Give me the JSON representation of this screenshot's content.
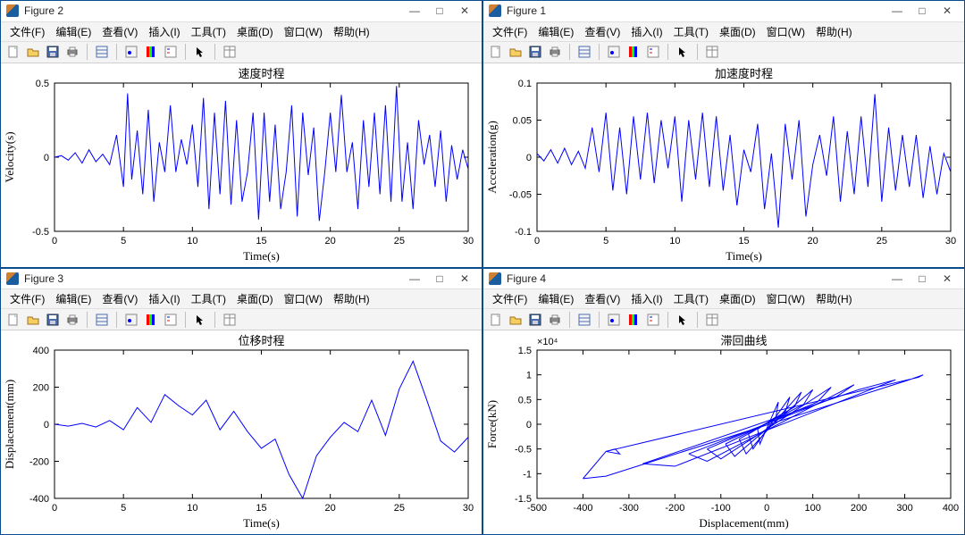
{
  "menus": {
    "file": "文件(F)",
    "edit": "编辑(E)",
    "view": "查看(V)",
    "insert": "插入(I)",
    "tool": "工具(T)",
    "desktop": "桌面(D)",
    "window": "窗口(W)",
    "help": "帮助(H)"
  },
  "windows": {
    "fig2": {
      "title": "Figure 2"
    },
    "fig1": {
      "title": "Figure 1"
    },
    "fig3": {
      "title": "Figure 3"
    },
    "fig4": {
      "title": "Figure 4"
    }
  },
  "winbtns": {
    "min": "—",
    "max": "□",
    "close": "✕"
  },
  "toolbar_icons": [
    "new",
    "open",
    "save",
    "print",
    "sep",
    "data",
    "sep",
    "datalabel",
    "colorbar",
    "legend",
    "sep",
    "pointer",
    "sep",
    "inspector"
  ],
  "chart_data": [
    {
      "id": "velocity",
      "type": "line",
      "title": "速度时程",
      "xlabel": "Time(s)",
      "ylabel": "Velocity(s)",
      "xlim": [
        0,
        30
      ],
      "ylim": [
        -0.5,
        0.5
      ],
      "xticks": [
        0,
        5,
        10,
        15,
        20,
        25,
        30
      ],
      "yticks": [
        -0.5,
        0,
        0.5
      ],
      "series": [
        {
          "name": "velocity",
          "x": [
            0,
            0.5,
            1,
            1.5,
            2,
            2.5,
            3,
            3.5,
            4,
            4.5,
            5,
            5.3,
            5.6,
            6,
            6.4,
            6.8,
            7.2,
            7.6,
            8,
            8.4,
            8.8,
            9.2,
            9.6,
            10,
            10.4,
            10.8,
            11.2,
            11.6,
            12,
            12.4,
            12.8,
            13.2,
            13.6,
            14,
            14.4,
            14.8,
            15.2,
            15.6,
            16,
            16.4,
            16.8,
            17.2,
            17.6,
            18,
            18.4,
            18.8,
            19.2,
            19.6,
            20,
            20.4,
            20.8,
            21.2,
            21.6,
            22,
            22.4,
            22.8,
            23.2,
            23.6,
            24,
            24.4,
            24.8,
            25.2,
            25.6,
            26,
            26.4,
            26.8,
            27.2,
            27.6,
            28,
            28.4,
            28.8,
            29.2,
            29.6,
            30
          ],
          "y": [
            0,
            0.01,
            -0.02,
            0.03,
            -0.04,
            0.05,
            -0.03,
            0.02,
            -0.05,
            0.15,
            -0.2,
            0.43,
            -0.15,
            0.18,
            -0.25,
            0.32,
            -0.3,
            0.1,
            -0.1,
            0.35,
            -0.1,
            0.12,
            -0.05,
            0.22,
            -0.2,
            0.4,
            -0.35,
            0.3,
            -0.25,
            0.38,
            -0.32,
            0.25,
            -0.3,
            -0.1,
            0.3,
            -0.42,
            0.3,
            -0.3,
            0.22,
            -0.35,
            -0.1,
            0.35,
            -0.4,
            0.3,
            -0.12,
            0.2,
            -0.43,
            -0.1,
            0.3,
            -0.1,
            0.42,
            -0.1,
            0.1,
            -0.35,
            0.25,
            -0.2,
            0.3,
            -0.25,
            0.35,
            -0.3,
            0.48,
            -0.3,
            0.1,
            -0.35,
            0.25,
            -0.05,
            0.15,
            -0.2,
            0.18,
            -0.3,
            0.08,
            -0.15,
            0.05,
            -0.08
          ]
        }
      ]
    },
    {
      "id": "acceleration",
      "type": "line",
      "title": "加速度时程",
      "xlabel": "Time(s)",
      "ylabel": "Acceleration(g)",
      "xlim": [
        0,
        30
      ],
      "ylim": [
        -0.1,
        0.1
      ],
      "xticks": [
        0,
        5,
        10,
        15,
        20,
        25,
        30
      ],
      "yticks": [
        -0.1,
        -0.05,
        0,
        0.05,
        0.1
      ],
      "series": [
        {
          "name": "accel",
          "x": [
            0,
            0.5,
            1,
            1.5,
            2,
            2.5,
            3,
            3.5,
            4,
            4.5,
            5,
            5.5,
            6,
            6.5,
            7,
            7.5,
            8,
            8.5,
            9,
            9.5,
            10,
            10.5,
            11,
            11.5,
            12,
            12.5,
            13,
            13.5,
            14,
            14.5,
            15,
            15.5,
            16,
            16.5,
            17,
            17.5,
            18,
            18.5,
            19,
            19.5,
            20,
            20.5,
            21,
            21.5,
            22,
            22.5,
            23,
            23.5,
            24,
            24.5,
            25,
            25.5,
            26,
            26.5,
            27,
            27.5,
            28,
            28.5,
            29,
            29.5,
            30
          ],
          "y": [
            0.005,
            -0.005,
            0.01,
            -0.008,
            0.012,
            -0.01,
            0.008,
            -0.015,
            0.04,
            -0.02,
            0.06,
            -0.045,
            0.04,
            -0.05,
            0.055,
            -0.03,
            0.06,
            -0.035,
            0.05,
            -0.015,
            0.055,
            -0.06,
            0.05,
            -0.03,
            0.06,
            -0.04,
            0.055,
            -0.045,
            0.03,
            -0.065,
            0.01,
            -0.02,
            0.045,
            -0.07,
            0.005,
            -0.095,
            0.045,
            -0.03,
            0.05,
            -0.08,
            -0.01,
            0.03,
            -0.025,
            0.055,
            -0.06,
            0.035,
            -0.05,
            0.055,
            -0.04,
            0.085,
            -0.06,
            0.04,
            -0.045,
            0.03,
            -0.04,
            0.03,
            -0.055,
            0.015,
            -0.05,
            0.005,
            -0.02
          ]
        }
      ]
    },
    {
      "id": "displacement",
      "type": "line",
      "title": "位移时程",
      "xlabel": "Time(s)",
      "ylabel": "Displacement(mm)",
      "xlim": [
        0,
        30
      ],
      "ylim": [
        -400,
        400
      ],
      "xticks": [
        0,
        5,
        10,
        15,
        20,
        25,
        30
      ],
      "yticks": [
        -400,
        -200,
        0,
        200,
        400
      ],
      "series": [
        {
          "name": "disp",
          "x": [
            0,
            1,
            2,
            3,
            4,
            5,
            6,
            7,
            8,
            9,
            10,
            11,
            12,
            13,
            14,
            15,
            16,
            17,
            18,
            19,
            20,
            21,
            22,
            23,
            24,
            25,
            26,
            27,
            28,
            29,
            30
          ],
          "y": [
            0,
            -10,
            5,
            -15,
            20,
            -30,
            90,
            10,
            160,
            100,
            50,
            130,
            -30,
            70,
            -40,
            -130,
            -80,
            -270,
            -400,
            -170,
            -70,
            10,
            -40,
            130,
            -60,
            190,
            340,
            130,
            -90,
            -150,
            -70
          ]
        }
      ]
    },
    {
      "id": "hysteresis",
      "type": "line",
      "title": "滞回曲线",
      "xlabel": "Displacement(mm)",
      "ylabel": "Force(kN)",
      "ylabel_mult": "×10⁴",
      "xlim": [
        -500,
        400
      ],
      "ylim": [
        -1.5,
        1.5
      ],
      "xticks": [
        -500,
        -400,
        -300,
        -200,
        -100,
        0,
        100,
        200,
        300,
        400
      ],
      "yticks": [
        -1.5,
        -1,
        -0.5,
        0,
        0.5,
        1,
        1.5
      ],
      "series": [
        {
          "name": "loop1",
          "x": [
            -20,
            20,
            25,
            -15,
            -20
          ],
          "y": [
            -0.1,
            0.15,
            0.45,
            -0.4,
            -0.1
          ]
        },
        {
          "name": "loop2",
          "x": [
            -40,
            40,
            50,
            -30,
            -40
          ],
          "y": [
            -0.2,
            0.25,
            0.55,
            -0.5,
            -0.2
          ]
        },
        {
          "name": "loop3",
          "x": [
            -60,
            60,
            75,
            -45,
            -60
          ],
          "y": [
            -0.3,
            0.35,
            0.65,
            -0.6,
            -0.3
          ]
        },
        {
          "name": "loop4",
          "x": [
            -90,
            80,
            100,
            -70,
            -90
          ],
          "y": [
            -0.4,
            0.4,
            0.7,
            -0.65,
            -0.4
          ]
        },
        {
          "name": "loop5",
          "x": [
            -130,
            110,
            140,
            -100,
            -130
          ],
          "y": [
            -0.5,
            0.45,
            0.75,
            -0.7,
            -0.5
          ]
        },
        {
          "name": "loop6",
          "x": [
            -170,
            150,
            190,
            -130,
            -170
          ],
          "y": [
            -0.6,
            0.55,
            0.8,
            -0.75,
            -0.6
          ]
        },
        {
          "name": "loop7",
          "x": [
            -270,
            200,
            280,
            -200,
            -270
          ],
          "y": [
            -0.8,
            0.7,
            0.9,
            -0.85,
            -0.8
          ]
        },
        {
          "name": "loop8",
          "x": [
            -400,
            -350,
            310,
            340,
            330,
            -350,
            -400
          ],
          "y": [
            -1.1,
            -1.05,
            0.9,
            1.0,
            0.95,
            -0.55,
            -1.1
          ]
        },
        {
          "name": "loop9",
          "x": [
            -350,
            -330,
            -320,
            -350
          ],
          "y": [
            -0.55,
            -0.5,
            -0.6,
            -0.55
          ]
        }
      ]
    }
  ]
}
